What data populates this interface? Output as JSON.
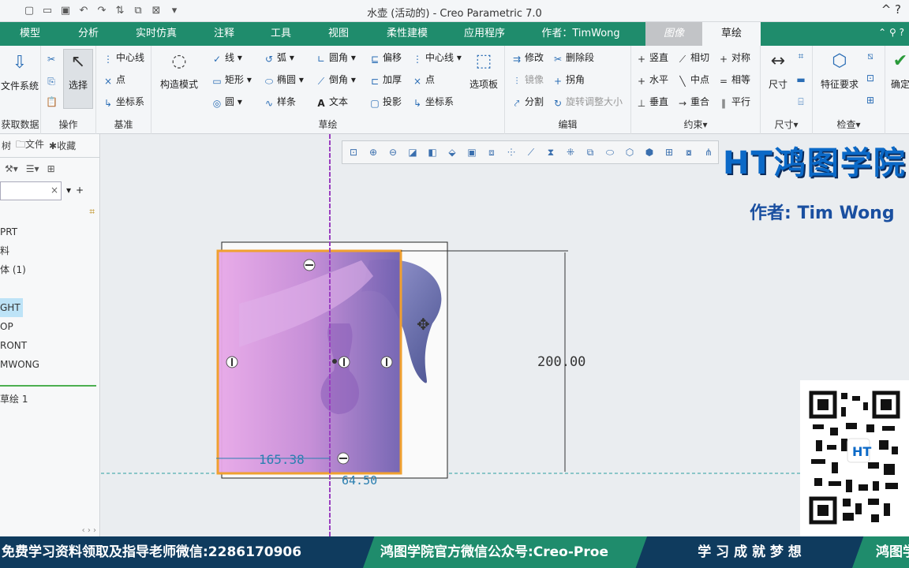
{
  "window": {
    "title": "水壶 (活动的) - Creo Parametric 7.0",
    "controls": "^ ?"
  },
  "tabs": [
    "模型",
    "分析",
    "实时仿真",
    "注释",
    "工具",
    "视图",
    "柔性建模",
    "应用程序",
    "作者：TimWong",
    "图像",
    "草绘"
  ],
  "ribbon": {
    "groups": {
      "data": "获取数据",
      "ops": "操作",
      "datum": "基准",
      "sketch": "草绘",
      "edit": "编辑",
      "constraint": "约束",
      "dim": "尺寸",
      "inspect": "检查"
    },
    "file_system": "文件系统",
    "select": "选择",
    "datum_items": [
      "中心线",
      "点",
      "坐标系"
    ],
    "construct_mode": "构造模式",
    "sketch_col1": [
      "线",
      "矩形",
      "圆"
    ],
    "sketch_col2": [
      "弧",
      "椭圆",
      "样条"
    ],
    "sketch_col3": [
      "圆角",
      "倒角",
      "文本"
    ],
    "sketch_col4": [
      "偏移",
      "加厚",
      "投影"
    ],
    "sketch_col5": [
      "中心线",
      "点",
      "坐标系"
    ],
    "palette": "选项板",
    "edit_items": [
      "修改",
      "删除段",
      "镜像",
      "拐角",
      "分割",
      "旋转调整大小"
    ],
    "constraint_items": [
      "竖直",
      "相切",
      "对称",
      "水平",
      "中点",
      "相等",
      "垂直",
      "重合",
      "平行"
    ],
    "dimension": "尺寸",
    "feature_req": "特征要求",
    "ok": "确定"
  },
  "left_panel": {
    "tabs": [
      "树",
      "文件",
      "收藏"
    ],
    "tree": [
      "PRT",
      "料",
      "体 (1)",
      "GHT",
      "OP",
      "RONT",
      "MWONG",
      "草绘 1"
    ],
    "selected_index": 3
  },
  "sketch": {
    "dim_height": "200.00",
    "dim_width": "165.38",
    "dim_small": "64.50"
  },
  "branding": {
    "logo": "HT鸿图学院",
    "author": "作者: Tim Wong",
    "watermark": "鸿图学院"
  },
  "banner": {
    "seg1": "免费学习资料领取及指导老师微信:2286170906",
    "seg2": "鸿图学院官方微信公众号:Creo-Proe",
    "seg3": "学 习 成 就 梦 想",
    "seg4": "鸿图学"
  },
  "colors": {
    "tab_green": "#1f8c6c",
    "orange_selection": "#f0a030",
    "purple_axis": "#9a3fc0",
    "pink_image": "#e6a3e6"
  }
}
